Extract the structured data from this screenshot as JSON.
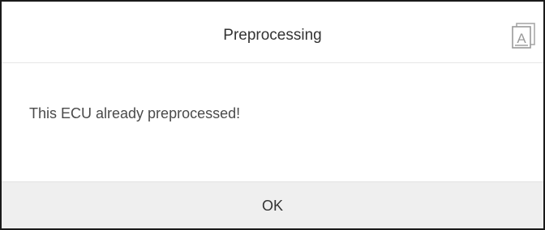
{
  "dialog": {
    "title": "Preprocessing",
    "translate_icon": "translate-a-icon",
    "message": "This ECU already preprocessed!",
    "ok_label": "OK"
  },
  "colors": {
    "border": "#1a1a1a",
    "footer_bg": "#efefef",
    "text": "#333333",
    "icon": "#9a9a9a"
  }
}
